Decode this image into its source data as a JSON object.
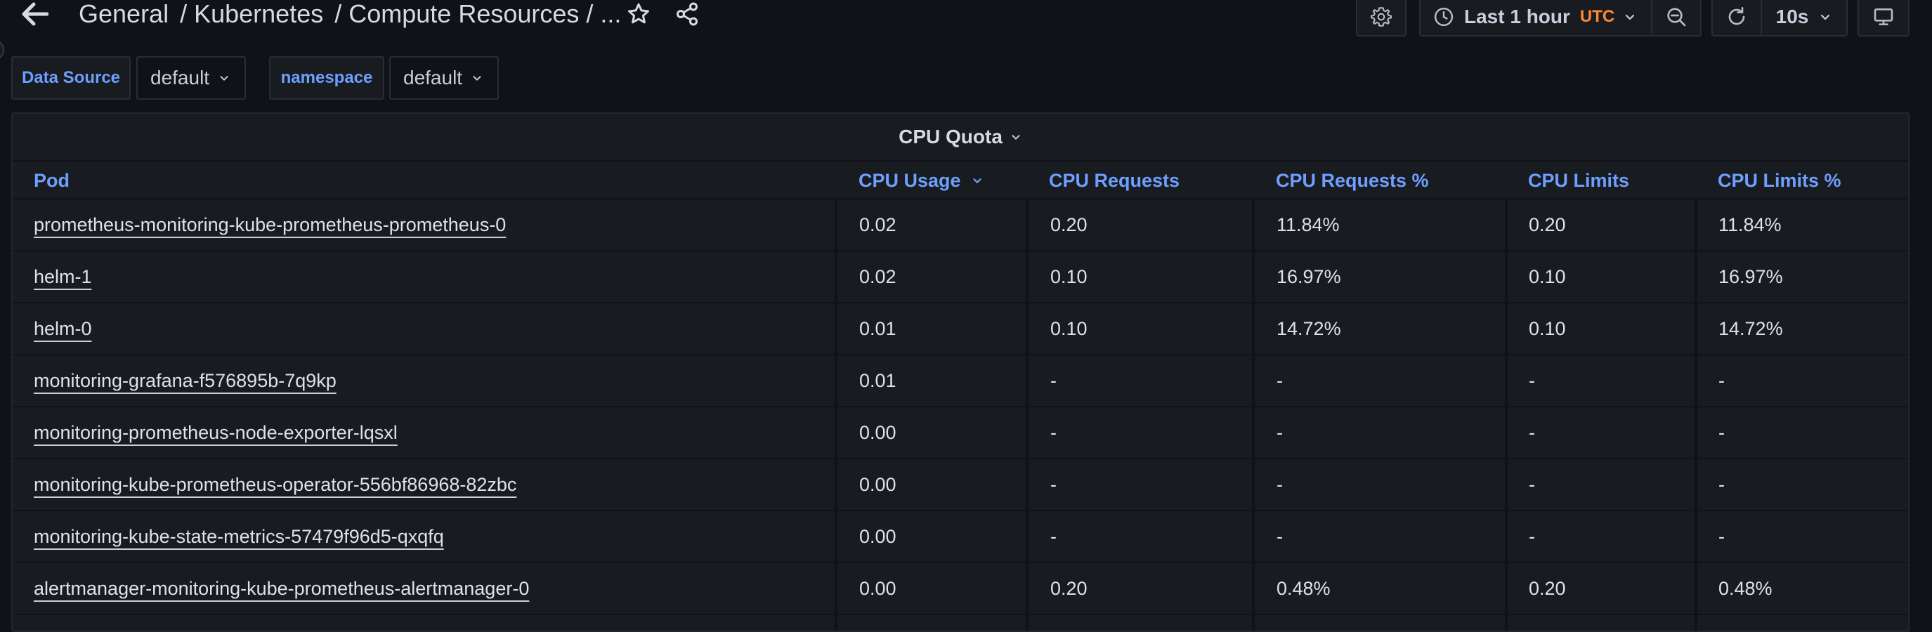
{
  "header": {
    "breadcrumb": [
      {
        "label": "General"
      },
      {
        "label": "Kubernetes"
      },
      {
        "label": "Compute Resources / ..."
      }
    ],
    "separator": "/",
    "icons": [
      "arrow-left-icon",
      "star-icon",
      "share-icon"
    ]
  },
  "toolbar": {
    "time_range": "Last 1 hour",
    "timezone": "UTC",
    "refresh_interval": "10s",
    "icons": [
      "gear-icon",
      "clock-icon",
      "chevron-down-icon",
      "zoom-out-icon",
      "refresh-icon",
      "monitor-icon"
    ]
  },
  "variables": [
    {
      "label": "Data Source",
      "value": "default"
    },
    {
      "label": "namespace",
      "value": "default"
    }
  ],
  "panel": {
    "title": "CPU Quota",
    "columns": [
      "Pod",
      "CPU Usage",
      "CPU Requests",
      "CPU Requests %",
      "CPU Limits",
      "CPU Limits %"
    ],
    "sort_column": "CPU Usage",
    "sort_direction": "descending",
    "rows": [
      [
        "prometheus-monitoring-kube-prometheus-prometheus-0",
        "0.02",
        "0.20",
        "11.84%",
        "0.20",
        "11.84%"
      ],
      [
        "helm-1",
        "0.02",
        "0.10",
        "16.97%",
        "0.10",
        "16.97%"
      ],
      [
        "helm-0",
        "0.01",
        "0.10",
        "14.72%",
        "0.10",
        "14.72%"
      ],
      [
        "monitoring-grafana-f576895b-7q9kp",
        "0.01",
        "-",
        "-",
        "-",
        "-"
      ],
      [
        "monitoring-prometheus-node-exporter-lqsxl",
        "0.00",
        "-",
        "-",
        "-",
        "-"
      ],
      [
        "monitoring-kube-prometheus-operator-556bf86968-82zbc",
        "0.00",
        "-",
        "-",
        "-",
        "-"
      ],
      [
        "monitoring-kube-state-metrics-57479f96d5-qxqfq",
        "0.00",
        "-",
        "-",
        "-",
        "-"
      ],
      [
        "alertmanager-monitoring-kube-prometheus-alertmanager-0",
        "0.00",
        "0.20",
        "0.48%",
        "0.20",
        "0.48%"
      ]
    ]
  },
  "colors": {
    "background": "#111217",
    "panel": "#181b1f",
    "accent_blue": "#6e9fff",
    "timezone_orange": "#ff8833",
    "text": "#ccccdc"
  }
}
